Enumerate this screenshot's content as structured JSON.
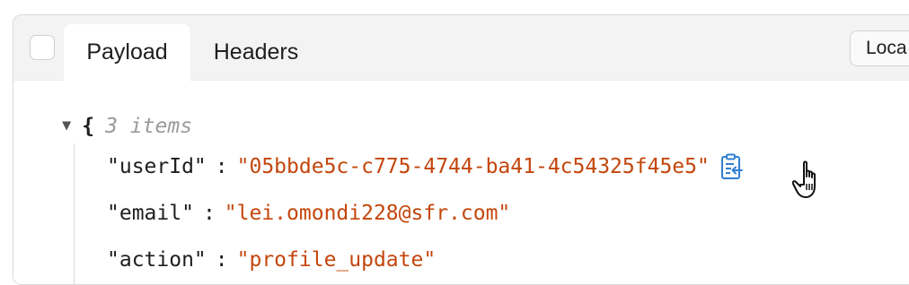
{
  "tabs": [
    {
      "label": "Payload",
      "active": true
    },
    {
      "label": "Headers",
      "active": false
    }
  ],
  "toolbar": {
    "locale_label": "Loca"
  },
  "tree": {
    "open_brace": "{",
    "item_count": "3 items",
    "entries": [
      {
        "key": "\"userId\"",
        "value": "\"05bbde5c-c775-4744-ba41-4c54325f45e5\""
      },
      {
        "key": "\"email\"",
        "value": "\"lei.omondi228@sfr.com\""
      },
      {
        "key": "\"action\"",
        "value": "\"profile_update\""
      }
    ],
    "separator": ":"
  },
  "icons": {
    "expand": "caret-down-icon",
    "copy": "copy-clipboard-icon",
    "cursor": "pointer-hand-cursor"
  },
  "colors": {
    "string_value": "#c4460c",
    "key": "#1e1e1e",
    "icon_blue": "#2f7fd1",
    "muted": "#9a9a9a"
  }
}
